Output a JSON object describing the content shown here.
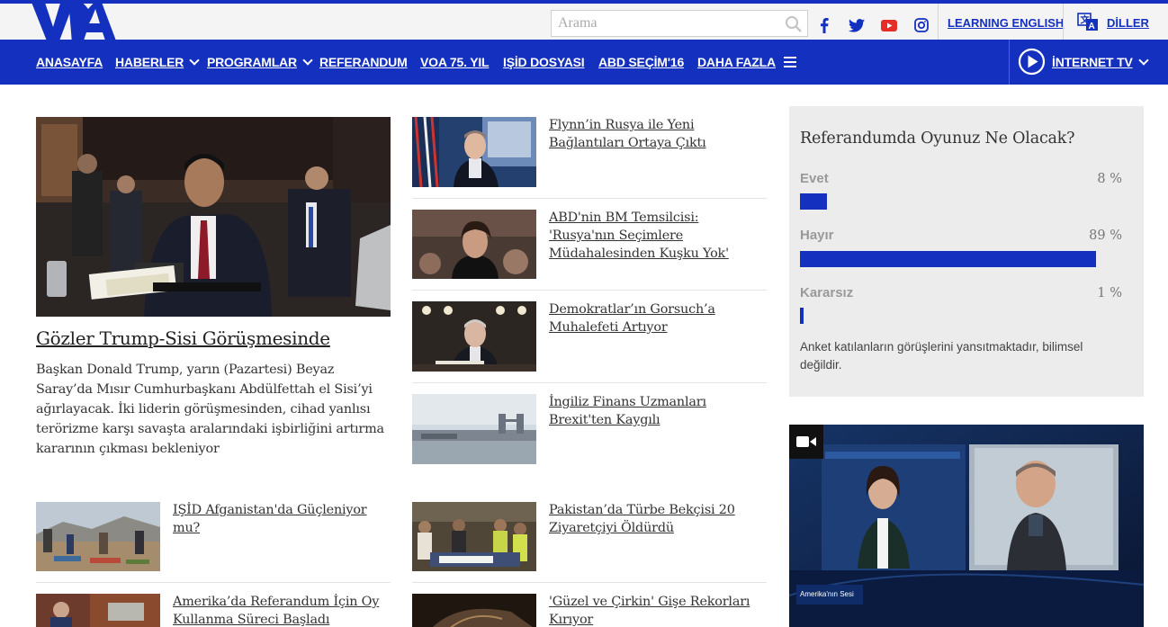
{
  "header": {
    "logo": "VOA",
    "search_placeholder": "Arama",
    "social": [
      "facebook-icon",
      "twitter-icon",
      "youtube-icon",
      "instagram-icon"
    ],
    "learning_english": "LEARNING ENGLISH",
    "languages": "DİLLER"
  },
  "nav": {
    "items": [
      "ANASAYFA",
      "HABERLER",
      "PROGRAMLAR",
      "REFERANDUM",
      "VOA 75. YIL",
      "IŞİD DOSYASI",
      "ABD SEÇİM'16",
      "DAHA FAZLA"
    ],
    "tv": "İNTERNET TV"
  },
  "hero": {
    "title": "Gözler Trump-Sisi Görüşmesinde",
    "description": "Başkan Donald Trump, yarın (Pazartesi) Beyaz Saray’da Mısır Cumhurbaşkanı Abdülfettah el Sisi’yi ağırlayacak. İki liderin görüşmesinden, cihad yanlısı terörizme karşı savaşta aralarındaki işbirliğini artırma kararının çıkması bekleniyor"
  },
  "stories_right": [
    "Flynn’in Rusya ile Yeni Bağlantıları Ortaya Çıktı",
    "ABD'nin BM Temsilcisi: 'Rusya'nın Seçimlere Müdahalesinden Kuşku Yok'",
    "Demokratlar’ın Gorsuch’a Muhalefeti Artıyor",
    "İngiliz Finans Uzmanları Brexit'ten Kaygılı",
    "Pakistan’da Türbe Bekçisi 20 Ziyaretçiyi Öldürdü",
    "'Güzel ve Çirkin' Gişe Rekorları Kırıyor"
  ],
  "stories_left": [
    "IŞİD Afganistan'da Güçleniyor mu?",
    "Amerika’da Referandum İçin Oy Kullanma Süreci Başladı"
  ],
  "poll": {
    "question": "Referandumda Oyunuz Ne Olacak?",
    "options": [
      {
        "label": "Evet",
        "percent_text": "8 %",
        "value": 8
      },
      {
        "label": "Hayır",
        "percent_text": "89 %",
        "value": 89
      },
      {
        "label": "Kararsız",
        "percent_text": "1 %",
        "value": 1
      }
    ],
    "note": "Anket katılanların görüşlerini yansıtmaktadır, bilimsel değildir."
  },
  "video": {
    "icon": "video-camera-icon",
    "lower_third": "Amerika'nın Sesi"
  },
  "colors": {
    "brand_blue": "#1330bf",
    "poll_bg": "#ececec",
    "topbar_bg": "#f4f4f4"
  }
}
